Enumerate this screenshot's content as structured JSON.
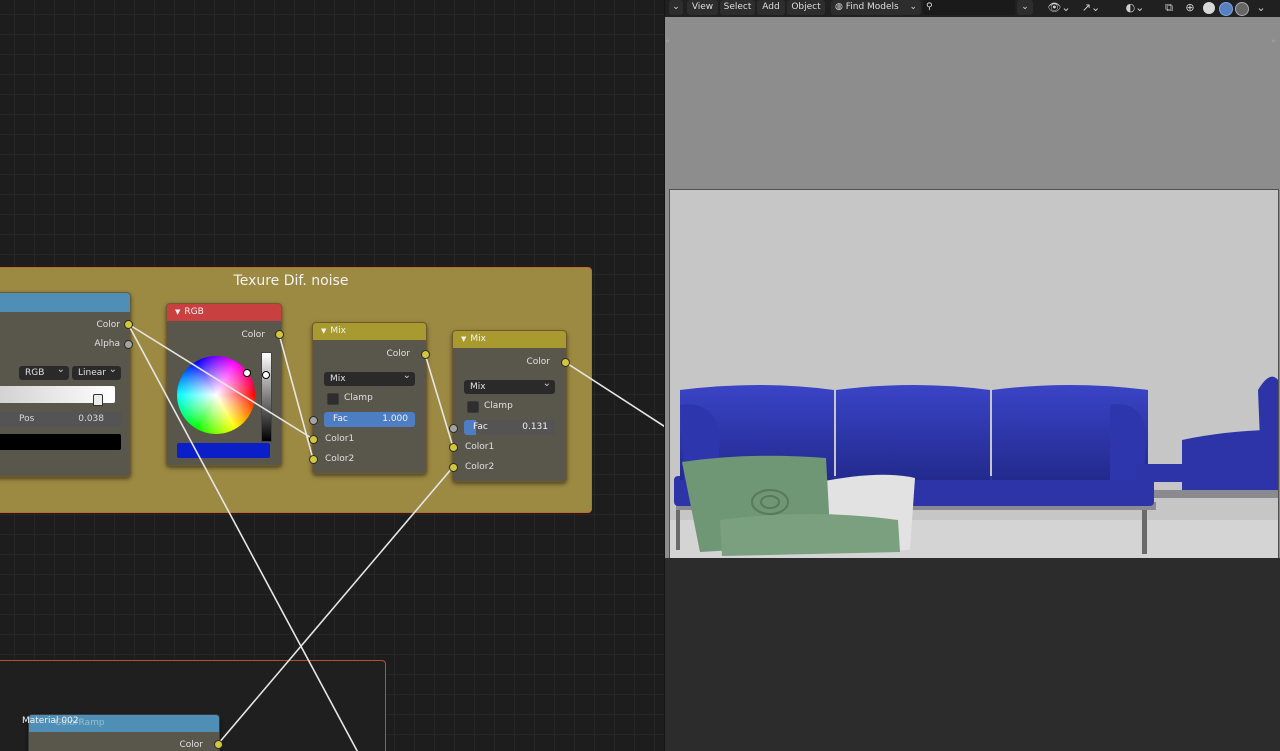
{
  "node_editor": {
    "frame_title": "Texure Dif. noise",
    "frame2_label": "Material.002",
    "colorramp": {
      "outputs": [
        "Color",
        "Alpha"
      ],
      "color_mode": "RGB",
      "interpolation": "Linear",
      "pos_label": "Pos",
      "pos_value": "0.038",
      "header_color": "#4f8fb6"
    },
    "rgb": {
      "title": "RGB",
      "output": "Color",
      "swatch": "#0a1fc8",
      "header_color": "#c94040"
    },
    "mix1": {
      "title": "Mix",
      "output": "Color",
      "blend": "Mix",
      "clamp_label": "Clamp",
      "fac_label": "Fac",
      "fac_value": "1.000",
      "fac": 1.0,
      "inputs": [
        "Color1",
        "Color2"
      ],
      "header_color": "#a89a2e"
    },
    "mix2": {
      "title": "Mix",
      "output": "Color",
      "blend": "Mix",
      "clamp_label": "Clamp",
      "fac_label": "Fac",
      "fac_value": "0.131",
      "fac": 0.131,
      "inputs": [
        "Color1",
        "Color2"
      ],
      "header_color": "#a89a2e"
    },
    "colorramp2": {
      "title": "ColorRamp",
      "output": "Color"
    }
  },
  "viewport": {
    "menus": [
      "View",
      "Select",
      "Add",
      "Object"
    ],
    "find_models": "Find Models",
    "scene_colors": {
      "sofa": "#2c34a8",
      "pillow": "#6f9675",
      "white_pillow": "#e2e2e2",
      "backdrop": "#c6c6c6"
    }
  }
}
